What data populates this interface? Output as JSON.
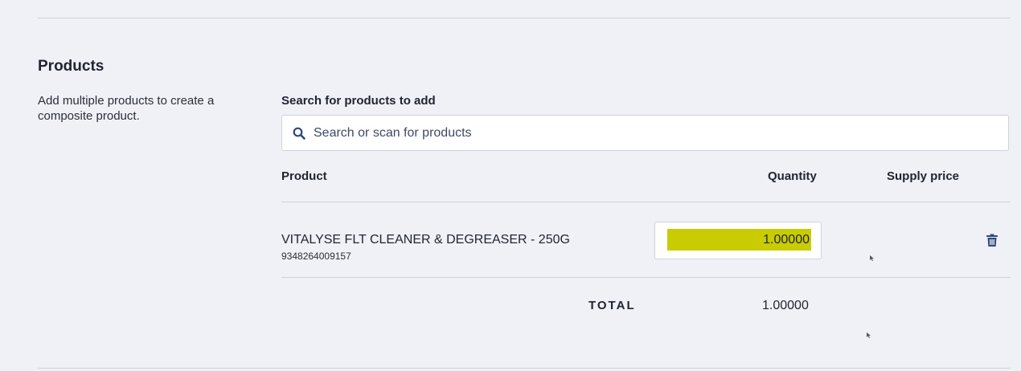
{
  "products_section": {
    "title": "Products",
    "description": "Add multiple products to create a composite product."
  },
  "search": {
    "label": "Search for products to add",
    "placeholder": "Search or scan for products",
    "value": "",
    "icon": "search-icon"
  },
  "table": {
    "columns": [
      "Product",
      "Quantity",
      "Supply price"
    ],
    "rows": [
      {
        "name": "VITALYSE FLT CLEANER & DEGREASER - 250G",
        "sku": "9348264009157",
        "quantity": "1.00000",
        "supply_price": "",
        "delete_icon": "trash-icon"
      }
    ],
    "total_label": "TOTAL",
    "total_quantity": "1.00000"
  },
  "colors": {
    "background": "#f0f1f6",
    "highlight": "#c9cc00",
    "icon": "#2e4a7a",
    "border": "#cfd2da"
  }
}
